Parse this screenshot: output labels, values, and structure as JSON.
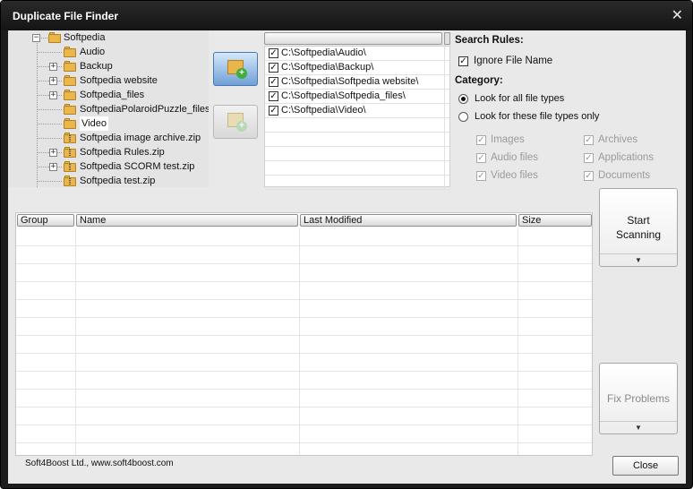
{
  "window": {
    "title": "Duplicate File Finder",
    "close_glyph": "✕"
  },
  "tree": {
    "root": "Softpedia",
    "items": [
      {
        "label": "Audio",
        "expandable": false,
        "type": "folder"
      },
      {
        "label": "Backup",
        "expandable": true,
        "type": "folder"
      },
      {
        "label": "Softpedia website",
        "expandable": true,
        "type": "folder"
      },
      {
        "label": "Softpedia_files",
        "expandable": true,
        "type": "folder"
      },
      {
        "label": "SoftpediaPolaroidPuzzle_files",
        "expandable": false,
        "type": "folder"
      },
      {
        "label": "Video",
        "expandable": false,
        "type": "folder",
        "selected": true
      },
      {
        "label": "Softpedia image archive.zip",
        "expandable": false,
        "type": "zip"
      },
      {
        "label": "Softpedia Rules.zip",
        "expandable": true,
        "type": "zip"
      },
      {
        "label": "Softpedia SCORM test.zip",
        "expandable": true,
        "type": "zip"
      },
      {
        "label": "Softpedia test.zip",
        "expandable": false,
        "type": "zip"
      }
    ]
  },
  "buttons": {
    "add_folder_icon": "folder-add-icon",
    "add_folder_disabled_icon": "folder-add-disabled-icon",
    "start_scanning_line1": "Start",
    "start_scanning_line2": "Scanning",
    "fix_problems": "Fix Problems",
    "dropdown_glyph": "▼",
    "close": "Close"
  },
  "paths": [
    {
      "checked": true,
      "path": "C:\\Softpedia\\Audio\\"
    },
    {
      "checked": true,
      "path": "C:\\Softpedia\\Backup\\"
    },
    {
      "checked": true,
      "path": "C:\\Softpedia\\Softpedia website\\"
    },
    {
      "checked": true,
      "path": "C:\\Softpedia\\Softpedia_files\\"
    },
    {
      "checked": true,
      "path": "C:\\Softpedia\\Video\\"
    }
  ],
  "rules": {
    "header": "Search Rules:",
    "ignore_file_name": "Ignore File Name",
    "ignore_checked": true,
    "category_header": "Category:",
    "look_all": "Look for all file types",
    "look_these": "Look for these file types only",
    "selected_option": "look_all",
    "types": [
      {
        "label": "Images",
        "checked": true
      },
      {
        "label": "Archives",
        "checked": true
      },
      {
        "label": "Audio files",
        "checked": true
      },
      {
        "label": "Applications",
        "checked": true
      },
      {
        "label": "Video files",
        "checked": true
      },
      {
        "label": "Documents",
        "checked": true
      }
    ]
  },
  "grid": {
    "columns": [
      "Group",
      "Name",
      "Last Modified",
      "Size"
    ],
    "rows": []
  },
  "footer": {
    "company": "Soft4Boost Ltd., www.soft4boost.com"
  },
  "colors": {
    "titlebar": "#1c1c1c",
    "client": "#e9e9e9",
    "folder": "#e8b64a"
  }
}
